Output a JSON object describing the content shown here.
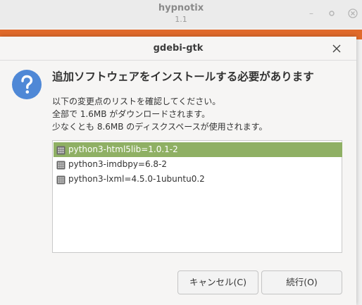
{
  "background_window": {
    "title": "hypnotix",
    "version": "1.1"
  },
  "dialog": {
    "title": "gdebi-gtk",
    "heading": "追加ソフトウェアをインストールする必要があります",
    "info_lines": [
      "以下の変更点のリストを確認してください。",
      "全部で 1.6MB がダウンロードされます。",
      "少なくとも 8.6MB のディスクスペースが使用されます。"
    ],
    "packages": [
      {
        "label": "python3-html5lib=1.0.1-2",
        "selected": true
      },
      {
        "label": "python3-imdbpy=6.8-2",
        "selected": false
      },
      {
        "label": "python3-lxml=4.5.0-1ubuntu0.2",
        "selected": false
      }
    ],
    "buttons": {
      "cancel": "キャンセル(C)",
      "continue": "続行(O)"
    }
  },
  "icons": {
    "dialog_icon": "question-icon",
    "package_icon": "package-grid-icon",
    "close": "close-icon"
  },
  "colors": {
    "selection": "#8fb064",
    "accent_orange": "#e06a2b",
    "question_icon": "#4f88d6"
  }
}
